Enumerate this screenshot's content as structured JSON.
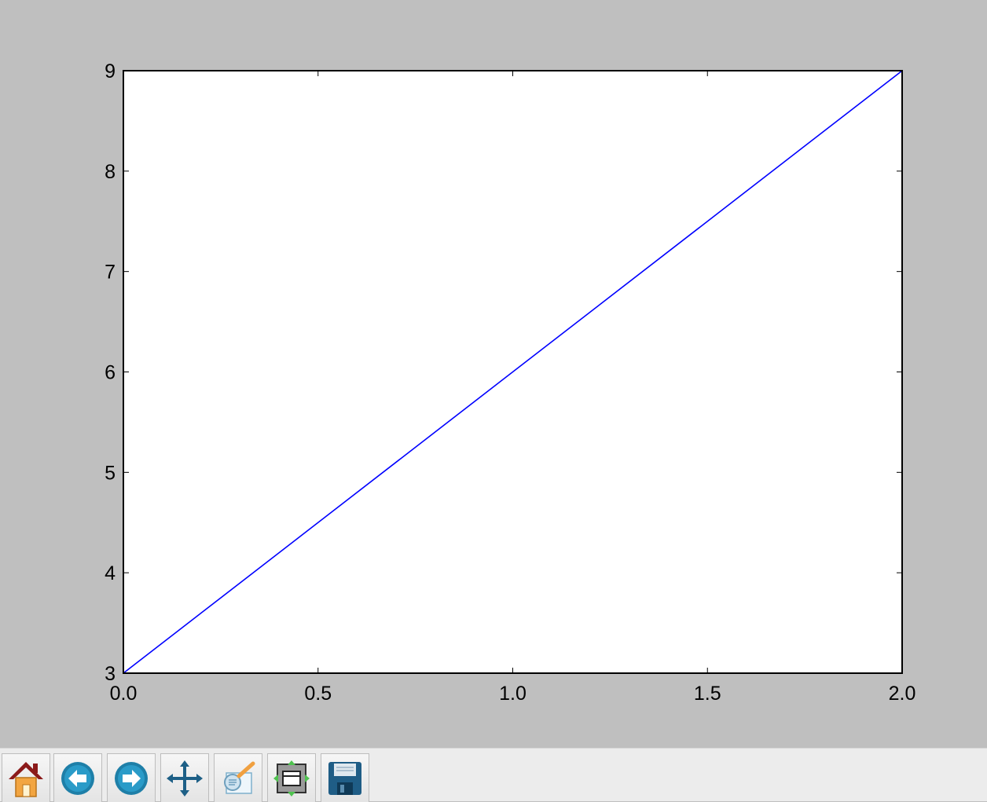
{
  "chart_data": {
    "type": "line",
    "title": "",
    "xlabel": "",
    "ylabel": "",
    "xlim": [
      0.0,
      2.0
    ],
    "ylim": [
      3,
      9
    ],
    "xticks": [
      "0.0",
      "0.5",
      "1.0",
      "1.5",
      "2.0"
    ],
    "yticks": [
      "3",
      "4",
      "5",
      "6",
      "7",
      "8",
      "9"
    ],
    "xtick_values": [
      0.0,
      0.5,
      1.0,
      1.5,
      2.0
    ],
    "ytick_values": [
      3,
      4,
      5,
      6,
      7,
      8,
      9
    ],
    "series": [
      {
        "x": [
          0.0,
          2.0
        ],
        "y": [
          3,
          9
        ],
        "color": "#0000ff"
      }
    ],
    "grid": false,
    "legend": "none"
  },
  "colors": {
    "figure_background": "#bfbfbf",
    "axes_background": "#ffffff",
    "line": "#0000ff",
    "toolbar_background": "#ececec"
  },
  "toolbar": {
    "buttons": [
      {
        "icon": "home-icon"
      },
      {
        "icon": "back-arrow-icon"
      },
      {
        "icon": "forward-arrow-icon"
      },
      {
        "icon": "pan-move-icon"
      },
      {
        "icon": "zoom-to-rect-icon"
      },
      {
        "icon": "configure-subplots-icon"
      },
      {
        "icon": "save-figure-icon"
      }
    ]
  }
}
